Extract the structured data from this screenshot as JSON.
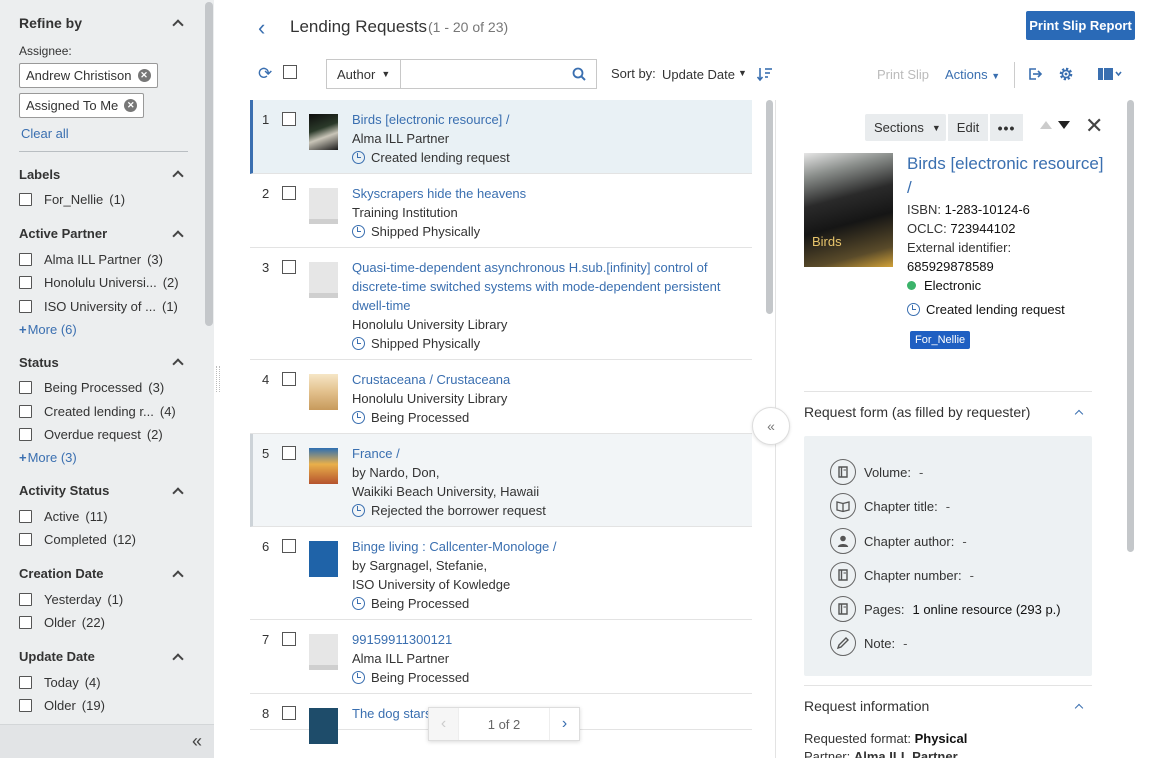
{
  "sidebar": {
    "title": "Refine by",
    "assignee_label": "Assignee:",
    "assignee_chips": [
      "Andrew Christison",
      "Assigned To Me"
    ],
    "clear_all": "Clear all",
    "facets": [
      {
        "name": "Labels",
        "items": [
          {
            "label": "For_Nellie",
            "count": "(1)"
          }
        ],
        "more": ""
      },
      {
        "name": "Active Partner",
        "items": [
          {
            "label": "Alma ILL Partner",
            "count": "(3)"
          },
          {
            "label": "Honolulu Universi...",
            "count": "(2)"
          },
          {
            "label": "ISO University of ...",
            "count": "(1)"
          }
        ],
        "more": "More (6)"
      },
      {
        "name": "Status",
        "items": [
          {
            "label": "Being Processed",
            "count": "(3)"
          },
          {
            "label": "Created lending r...",
            "count": "(4)"
          },
          {
            "label": "Overdue request",
            "count": "(2)"
          }
        ],
        "more": "More (3)"
      },
      {
        "name": "Activity Status",
        "items": [
          {
            "label": "Active",
            "count": "(11)"
          },
          {
            "label": "Completed",
            "count": "(12)"
          }
        ],
        "more": ""
      },
      {
        "name": "Creation Date",
        "items": [
          {
            "label": "Yesterday",
            "count": "(1)"
          },
          {
            "label": "Older",
            "count": "(22)"
          }
        ],
        "more": ""
      },
      {
        "name": "Update Date",
        "items": [
          {
            "label": "Today",
            "count": "(4)"
          },
          {
            "label": "Older",
            "count": "(19)"
          }
        ],
        "more": ""
      }
    ]
  },
  "header": {
    "title": "Lending Requests",
    "count": "(1 - 20 of 23)",
    "print_report": "Print Slip Report"
  },
  "toolbar": {
    "search_field": "Author",
    "search_value": "",
    "sort_label": "Sort by:",
    "sort_value": "Update Date",
    "print_slip": "Print Slip",
    "actions": "Actions"
  },
  "list": [
    {
      "num": "1",
      "title": "Birds [electronic resource] /",
      "lines": [
        "Alma ILL Partner"
      ],
      "status": "Created lending request",
      "thumb": "birds"
    },
    {
      "num": "2",
      "title": "Skyscrapers hide the heavens",
      "lines": [
        "Training Institution"
      ],
      "status": "Shipped Physically",
      "thumb": ""
    },
    {
      "num": "3",
      "title": "Quasi-time-dependent asynchronous H.sub.[infinity] control of discrete-time switched systems with mode-dependent persistent dwell-time",
      "lines": [
        "Honolulu University Library"
      ],
      "status": "Shipped Physically",
      "thumb": ""
    },
    {
      "num": "4",
      "title": "Crustaceana / Crustaceana",
      "lines": [
        "Honolulu University Library"
      ],
      "status": "Being Processed",
      "thumb": "crust"
    },
    {
      "num": "5",
      "title": "France /",
      "lines": [
        "by Nardo, Don,",
        "Waikiki Beach University, Hawaii"
      ],
      "status": "Rejected the borrower request",
      "thumb": "france"
    },
    {
      "num": "6",
      "title": "Binge living : Callcenter-Monologe /",
      "lines": [
        "by Sargnagel, Stefanie,",
        "ISO University of Kowledge"
      ],
      "status": "Being Processed",
      "thumb": "binge"
    },
    {
      "num": "7",
      "title": "99159911300121",
      "lines": [
        "Alma ILL Partner"
      ],
      "status": "Being Processed",
      "thumb": ""
    },
    {
      "num": "8",
      "title": "The dog stars /",
      "lines": [
        ""
      ],
      "status": "",
      "thumb": "dog"
    }
  ],
  "pager": {
    "info": "1 of 2"
  },
  "detail": {
    "sections": "Sections",
    "edit": "Edit",
    "more": "•••",
    "cover_text": "Birds",
    "title": "Birds [electronic resource] /",
    "isbn_label": "ISBN:",
    "isbn": "1-283-10124-6",
    "oclc_label": "OCLC:",
    "oclc": "723944102",
    "extid_label": "External identifier:",
    "extid": "685929878589",
    "electronic": "Electronic",
    "status": "Created lending request",
    "tag": "For_Nellie",
    "request_form_title": "Request form (as filled by requester)",
    "form_fields": [
      {
        "label": "Volume:",
        "value": "-",
        "icon": "book-icon"
      },
      {
        "label": "Chapter title:",
        "value": "-",
        "icon": "open-book-icon"
      },
      {
        "label": "Chapter author:",
        "value": "-",
        "icon": "person-icon"
      },
      {
        "label": "Chapter number:",
        "value": "-",
        "icon": "book-icon"
      },
      {
        "label": "Pages:",
        "value": "1 online resource (293 p.)",
        "icon": "book-icon"
      },
      {
        "label": "Note:",
        "value": "-",
        "icon": "pencil-icon"
      }
    ],
    "request_info_title": "Request information",
    "format_label": "Requested format:",
    "format_value": "Physical",
    "partner_label": "Partner:",
    "partner_value": "Alma ILL Partner"
  },
  "colors": {
    "accent": "#3a6fb0",
    "primary_button": "#2a6ab7",
    "tag": "#1f5fc2",
    "online": "#3bb36a"
  }
}
